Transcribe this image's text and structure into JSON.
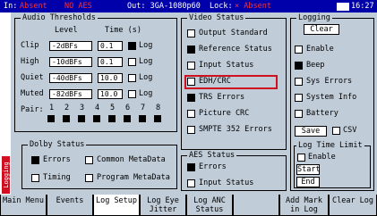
{
  "topbar": {
    "in_label": "In:",
    "in_value": "Absent",
    "aes_status": "NO AES",
    "out": "Out: 3GA-1080p60",
    "lock_label": "Lock:",
    "lock_value": "× Absent",
    "time": "16:27"
  },
  "sidetab": {
    "label": "Logging"
  },
  "audio_thresholds": {
    "title": "Audio Thresholds",
    "col_level": "Level",
    "col_time": "Time (s)",
    "rows": [
      {
        "name": "Clip",
        "level": "-2dBFs",
        "time": "0.1",
        "log_checked": true,
        "log_label": "Log"
      },
      {
        "name": "High",
        "level": "-10dBFs",
        "time": "0.1",
        "log_checked": false,
        "log_label": "Log"
      },
      {
        "name": "Quiet",
        "level": "-40dBFs",
        "time": "10.0",
        "log_checked": false,
        "log_label": "Log"
      },
      {
        "name": "Muted",
        "level": "-82dBFs",
        "time": "10.0",
        "log_checked": false,
        "log_label": "Log"
      }
    ],
    "pair_label": "Pair:",
    "pairs": [
      "1",
      "2",
      "3",
      "4",
      "5",
      "6",
      "7",
      "8"
    ]
  },
  "video_status": {
    "title": "Video Status",
    "items": [
      {
        "label": "Output Standard",
        "checked": false
      },
      {
        "label": "Reference Status",
        "checked": true
      },
      {
        "label": "Input Status",
        "checked": false
      },
      {
        "label": "EDH/CRC",
        "checked": false
      },
      {
        "label": "TRS Errors",
        "checked": true
      },
      {
        "label": "Picture CRC",
        "checked": false
      },
      {
        "label": "SMPTE 352 Errors",
        "checked": false
      }
    ]
  },
  "logging": {
    "title": "Logging",
    "clear_button": "Clear",
    "items": [
      {
        "label": "Enable",
        "checked": false
      },
      {
        "label": "Beep",
        "checked": true
      },
      {
        "label": "Sys Errors",
        "checked": false
      },
      {
        "label": "System Info",
        "checked": false
      },
      {
        "label": "Battery",
        "checked": false
      }
    ],
    "save_button": "Save",
    "csv_label": "CSV",
    "csv_checked": false
  },
  "log_time_limit": {
    "title": "Log Time Limit",
    "enable_label": "Enable",
    "start_button": "Start",
    "end_button": "End"
  },
  "dolby_status": {
    "title": "Dolby Status",
    "errors_label": "Errors",
    "errors_checked": true,
    "common_label": "Common MetaData",
    "timing_label": "Timing",
    "program_label": "Program MetaData"
  },
  "aes_status": {
    "title": "AES Status",
    "errors_label": "Errors",
    "errors_checked": true,
    "input_label": "Input Status"
  },
  "softkeys": [
    {
      "line1": "Main Menu",
      "line2": ""
    },
    {
      "line1": "Events",
      "line2": ""
    },
    {
      "line1": "Log Setup",
      "line2": ""
    },
    {
      "line1": "Log Eye",
      "line2": "Jitter"
    },
    {
      "line1": "Log ANC",
      "line2": "Status"
    },
    {
      "line1": "",
      "line2": ""
    },
    {
      "line1": "Add Mark",
      "line2": "in Log"
    },
    {
      "line1": "Clear Log",
      "line2": ""
    }
  ]
}
